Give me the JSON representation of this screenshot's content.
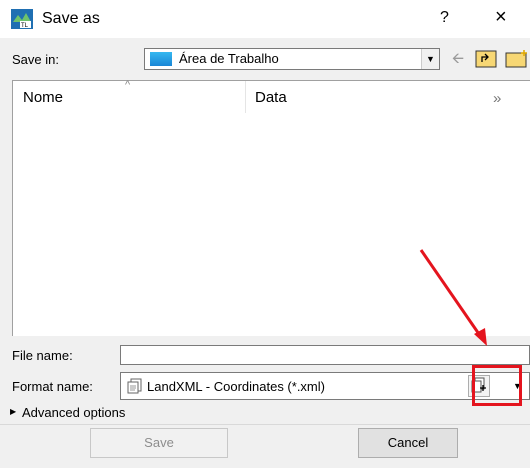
{
  "window": {
    "title": "Save as",
    "help_label": "?",
    "close_label": "×"
  },
  "toolbar": {
    "save_in_label": "Save in:",
    "location": "Área de Trabalho"
  },
  "file_list": {
    "columns": [
      "Nome",
      "Data"
    ],
    "more_columns_glyph": "»"
  },
  "fields": {
    "file_name_label": "File name:",
    "file_name_value": "",
    "format_name_label": "Format name:",
    "format_value": "LandXML - Coordinates (*.xml)"
  },
  "advanced_options_label": "Advanced options",
  "buttons": {
    "save": "Save",
    "cancel": "Cancel"
  },
  "colors": {
    "highlight": "#e4141e",
    "dialog_bg": "#f0f0f0"
  }
}
